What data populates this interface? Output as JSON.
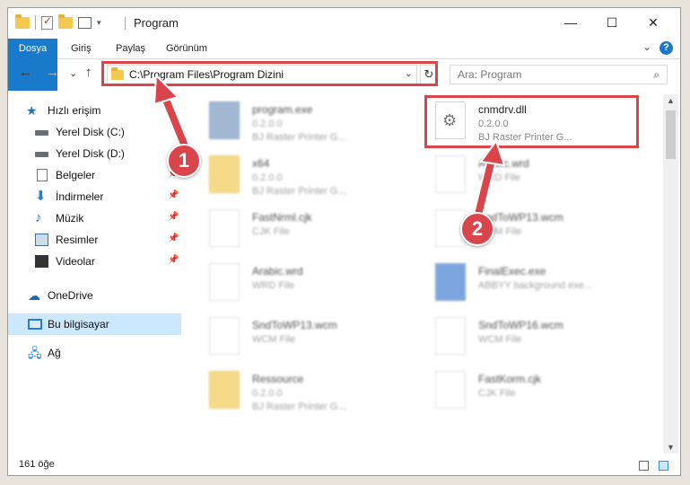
{
  "window": {
    "title": "Program",
    "minimize": "—",
    "maximize": "☐",
    "close": "✕"
  },
  "ribbon": {
    "tabs": [
      "Dosya",
      "Giriş",
      "Paylaş",
      "Görünüm"
    ],
    "help": "?",
    "collapse": "⌄"
  },
  "nav": {
    "back": "←",
    "forward": "→",
    "recent": "⌄",
    "up": "↑",
    "address": "C:\\Program Files\\Program Dizini",
    "refresh": "↻",
    "search_placeholder": "Ara: Program"
  },
  "sidebar": {
    "items": [
      {
        "label": "Hızlı erişim"
      },
      {
        "label": "Yerel Disk (C:)"
      },
      {
        "label": "Yerel Disk (D:)"
      },
      {
        "label": "Belgeler"
      },
      {
        "label": "İndirmeler"
      },
      {
        "label": "Müzik"
      },
      {
        "label": "Resimler"
      },
      {
        "label": "Videolar"
      },
      {
        "label": "OneDrive"
      },
      {
        "label": "Bu bilgisayar"
      },
      {
        "label": "Ağ"
      }
    ]
  },
  "files": [
    {
      "name": "program.exe",
      "meta1": "0.2.0.0",
      "meta2": "BJ Raster Printer G..."
    },
    {
      "name": "cnmdrv.dll",
      "meta1": "0.2.0.0",
      "meta2": "BJ Raster Printer G..."
    },
    {
      "name": "x64",
      "meta1": "0.2.0.0",
      "meta2": "BJ Raster Printer G..."
    },
    {
      "name": "Arabic.wrd",
      "meta1": "WRD File",
      "meta2": ""
    },
    {
      "name": "FastNrml.cjk",
      "meta1": "CJK File",
      "meta2": ""
    },
    {
      "name": "SndToWP13.wcm",
      "meta1": "WCM File",
      "meta2": ""
    },
    {
      "name": "Arabic.wrd",
      "meta1": "WRD File",
      "meta2": ""
    },
    {
      "name": "FinalExec.exe",
      "meta1": "ABBYY background exe...",
      "meta2": ""
    },
    {
      "name": "SndToWP13.wcm",
      "meta1": "WCM File",
      "meta2": ""
    },
    {
      "name": "SndToWP16.wcm",
      "meta1": "WCM File",
      "meta2": ""
    },
    {
      "name": "Ressource",
      "meta1": "0.2.0.0",
      "meta2": "BJ Raster Printer G..."
    },
    {
      "name": "FastKorm.cjk",
      "meta1": "CJK File",
      "meta2": ""
    }
  ],
  "status": {
    "count": "161 öğe"
  },
  "callouts": {
    "one": "1",
    "two": "2"
  },
  "colors": {
    "accent": "#1979ca",
    "highlight": "#d9454a",
    "selected": "#cce8ff"
  }
}
